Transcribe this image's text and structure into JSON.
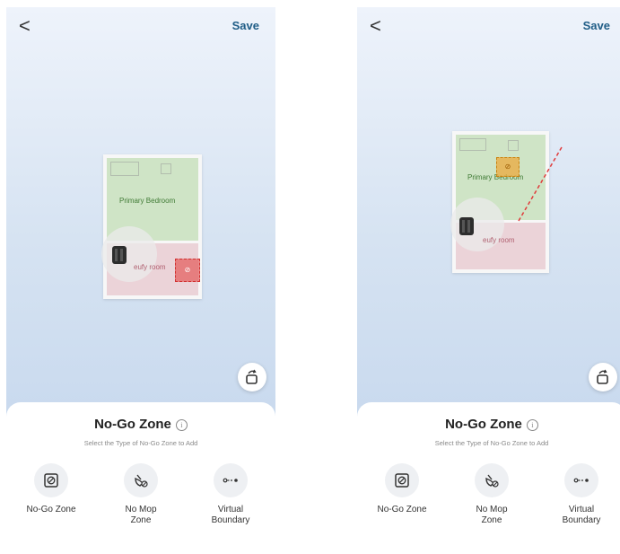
{
  "screens": [
    {
      "nav": {
        "back_label": "<",
        "save_label": "Save"
      },
      "map": {
        "rooms": {
          "primary_bedroom": "Primary Bedroom",
          "eufy_room": "eufy room"
        }
      },
      "panel": {
        "title": "No-Go Zone",
        "subtitle": "Select the Type of No-Go Zone to Add",
        "options": [
          {
            "label": "No-Go Zone",
            "icon": "no-go-zone-icon"
          },
          {
            "label": "No Mop\nZone",
            "icon": "no-mop-zone-icon"
          },
          {
            "label": "Virtual\nBoundary",
            "icon": "virtual-boundary-icon"
          }
        ]
      }
    },
    {
      "nav": {
        "back_label": "<",
        "save_label": "Save"
      },
      "map": {
        "rooms": {
          "primary_bedroom": "Primary Bedroom",
          "eufy_room": "eufy room"
        }
      },
      "panel": {
        "title": "No-Go Zone",
        "subtitle": "Select the Type of No-Go Zone to Add",
        "options": [
          {
            "label": "No-Go Zone",
            "icon": "no-go-zone-icon"
          },
          {
            "label": "No Mop\nZone",
            "icon": "no-mop-zone-icon"
          },
          {
            "label": "Virtual\nBoundary",
            "icon": "virtual-boundary-icon"
          }
        ]
      }
    }
  ],
  "colors": {
    "accent": "#1f5d86",
    "bedroom": "#cfe4c6",
    "eufy_room": "#ebd3d8",
    "no_go_zone": "#e45050",
    "no_mop_zone": "#ecaa3c",
    "virtual_boundary": "#e03a3a"
  }
}
